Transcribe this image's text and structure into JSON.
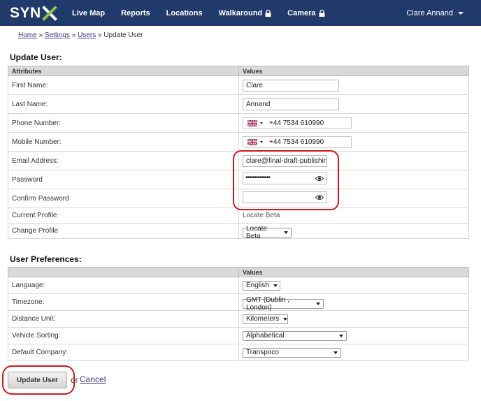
{
  "header": {
    "logo_text": "SYN",
    "nav": [
      "Live Map",
      "Reports",
      "Locations",
      "Walkaround",
      "Camera"
    ],
    "user_name": "Clare Annand",
    "brand_color": "#1f3a6b",
    "accent_color": "#8cc63f"
  },
  "breadcrumb": {
    "home": "Home",
    "sep": "»",
    "settings": "Settings",
    "users": "Users",
    "current": "Update User"
  },
  "update_user": {
    "title": "Update User:",
    "col_attributes": "Attributes",
    "col_values": "Values",
    "first_name_label": "First Name:",
    "first_name_value": "Clare",
    "last_name_label": "Last Name:",
    "last_name_value": "Annand",
    "phone_label": "Phone Number:",
    "phone_value": "+44 7534 610990",
    "mobile_label": "Mobile Number:",
    "mobile_value": "+44 7534 610990",
    "email_label": "Email Address:",
    "email_value": "clare@final-draft-publishing",
    "password_label": "Password",
    "password_mask": "••••••••••••••",
    "confirm_label": "Confirm Password",
    "current_profile_label": "Current Profile",
    "current_profile_value": "Locate Beta",
    "change_profile_label": "Change Profile",
    "change_profile_value": "Locate Beta"
  },
  "prefs": {
    "title": "User Preferences:",
    "col_values": "Values",
    "language_label": "Language:",
    "language_value": "English",
    "timezone_label": "Timezone:",
    "timezone_value": "GMT (Dublin , London)",
    "distance_label": "Distance Unit:",
    "distance_value": "Kilometers",
    "sorting_label": "Vehicle Sorting:",
    "sorting_value": "Alphabetical",
    "company_label": "Default Company:",
    "company_value": "Transpoco"
  },
  "actions": {
    "update_label": "Update User",
    "or_text": "or",
    "cancel_label": "Cancel"
  }
}
